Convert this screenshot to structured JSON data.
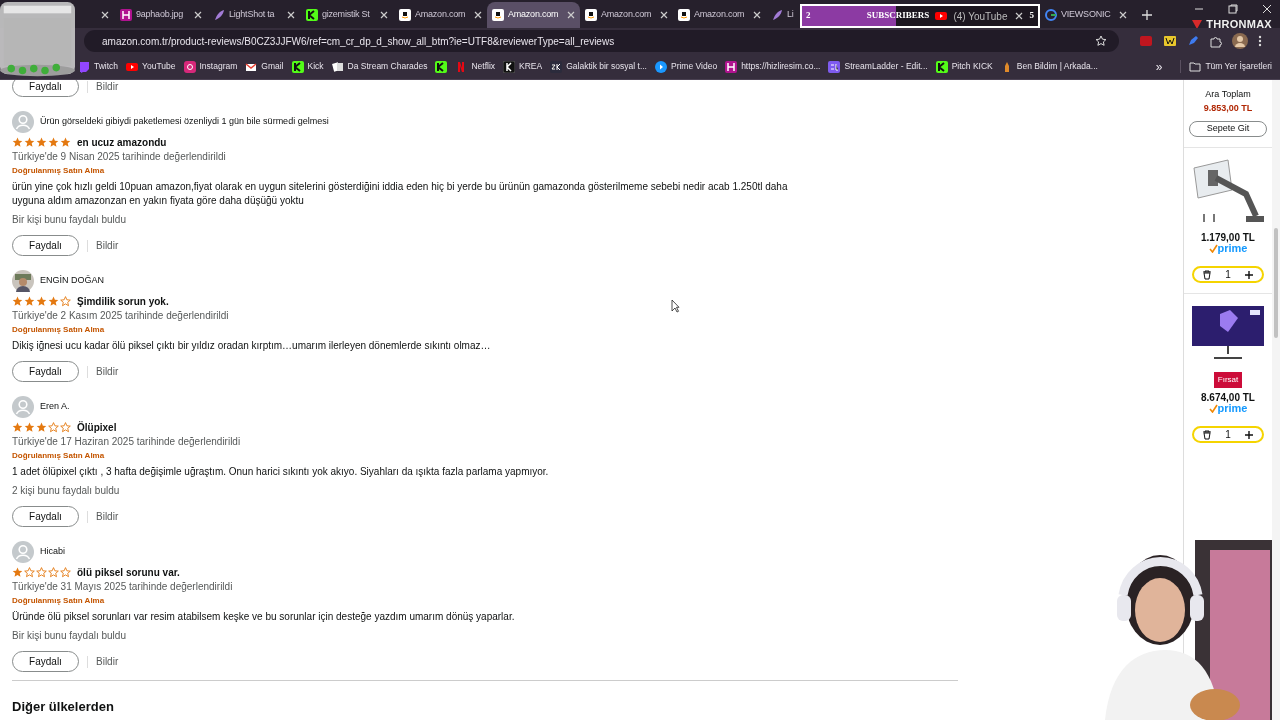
{
  "browser": {
    "tabs_left": [
      {
        "selected": false
      },
      {
        "label": "9aphaob.jpg",
        "selected": false
      },
      {
        "label": "LightShot ta",
        "selected": false
      },
      {
        "label": "gizemistik St",
        "selected": false
      },
      {
        "label": "Amazon.com",
        "selected": false
      },
      {
        "label": "Amazon.com",
        "selected": true
      },
      {
        "label": "Amazon.com",
        "selected": false
      },
      {
        "label": "Amazon.com",
        "selected": false
      },
      {
        "label": "Li",
        "selected": false
      }
    ],
    "subscriber_goal": {
      "current": "2",
      "label": "SUBSCRIBERS",
      "tab_label": "(4) YouTube",
      "target": "5",
      "level": 0.4
    },
    "tabs_right": [
      {
        "label": "VIEWSONIC",
        "selected": false
      }
    ],
    "overlay_logo": "THRONMAX",
    "url": "amazon.com.tr/product-reviews/B0CZ3JJFW6/ref=cm_cr_dp_d_show_all_btm?ie=UTF8&reviewerType=all_reviews",
    "bookmarks": [
      {
        "kind": "link",
        "label": "Twitch"
      },
      {
        "kind": "link",
        "label": "YouTube"
      },
      {
        "kind": "link",
        "label": "Instagram"
      },
      {
        "kind": "link",
        "label": "Gmail"
      },
      {
        "kind": "link",
        "label": "Kick"
      },
      {
        "kind": "link",
        "label": "Da Stream Charades"
      },
      {
        "kind": "icon"
      },
      {
        "kind": "link",
        "label": "Netflix"
      },
      {
        "kind": "link",
        "label": "KREA"
      },
      {
        "kind": "link",
        "label": "Galaktik bir sosyal t..."
      },
      {
        "kind": "link",
        "label": "Prime Video"
      },
      {
        "kind": "link",
        "label": "https://hizliresim.co..."
      },
      {
        "kind": "link",
        "label": "StreamLadder - Edit..."
      },
      {
        "kind": "link",
        "label": "Pitch KICK"
      },
      {
        "kind": "link",
        "label": "Ben Bildim | Arkada..."
      }
    ],
    "more_bookmarks": "»",
    "all_bookmarks": "Tüm Yer İşaretleri"
  },
  "top_actions": {
    "helpful": "Faydalı",
    "report": "Bildir"
  },
  "reviews": [
    {
      "name": "Ürün görseldeki gibiydi paketlemesi özenliydi 1 gün bile sürmedi gelmesi",
      "stars": 5,
      "title": "en ucuz amazondu",
      "date": "Türkiye'de 9 Nisan 2025 tarihinde değerlendirildi",
      "verified": "Doğrulanmış Satın Alma",
      "body": "ürün yine çok hızlı geldi 10puan amazon,fiyat olarak en uygun sitelerini gösterdiğini iddia eden hiç bi yerde bu ürünün gamazonda gösterilmeme sebebi nedir acab 1.250tl daha uyguna aldım amazonzan en yakın fiyata göre daha düşüğü yoktu",
      "helpful_count": "Bir kişi bunu faydalı buldu",
      "helpful": "Faydalı",
      "report": "Bildir"
    },
    {
      "name": "ENGİN DOĞAN",
      "stars": 4,
      "title": "Şimdilik sorun yok.",
      "date": "Türkiye'de 2 Kasım 2025 tarihinde değerlendirildi",
      "verified": "Doğrulanmış Satın Alma",
      "body": "Dikiş iğnesi ucu kadar ölü piksel çıktı bir yıldız oradan kırptım…umarım ilerleyen dönemlerde sıkıntı olmaz…",
      "helpful": "Faydalı",
      "report": "Bildir"
    },
    {
      "name": "Eren A.",
      "stars": 3,
      "title": "Ölüpixel",
      "date": "Türkiye'de 17 Haziran 2025 tarihinde değerlendirildi",
      "verified": "Doğrulanmış Satın Alma",
      "body": "1 adet ölüpixel çıktı , 3 hafta değişimle uğraştım. Onun harici sıkıntı yok akıyo. Siyahları da ışıkta fazla parlama yapmıyor.",
      "helpful_count": "2 kişi bunu faydalı buldu",
      "helpful": "Faydalı",
      "report": "Bildir"
    },
    {
      "name": "Hicabi",
      "stars": 1,
      "title": "ölü piksel sorunu var.",
      "date": "Türkiye'de 31 Mayıs 2025 tarihinde değerlendirildi",
      "verified": "Doğrulanmış Satın Alma",
      "body": "Üründe ölü piksel sorunları var resim atabilsem keşke ve bu sorunlar için desteğe yazdım umarım dönüş yaparlar.",
      "helpful_count": "Bir kişi bunu faydalı buldu",
      "helpful": "Faydalı",
      "report": "Bildir"
    }
  ],
  "other_countries_heading": "Diğer ülkelerden",
  "cart": {
    "subtotal_label": "Ara Toplam",
    "subtotal": "9.853,00 TL",
    "go_to_cart": "Sepete Git",
    "items": [
      {
        "kind": "arm",
        "price": "1.179,00 TL",
        "prime": "prime",
        "quantity": "1"
      },
      {
        "kind": "monitor",
        "badge": "Fırsat",
        "price": "8.674,00 TL",
        "prime": "prime",
        "quantity": "1"
      }
    ]
  }
}
